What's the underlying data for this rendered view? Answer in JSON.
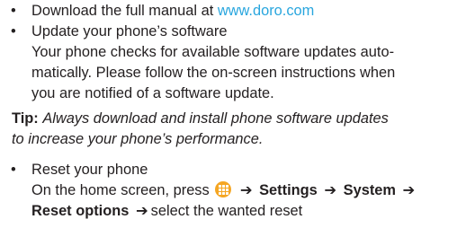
{
  "items": [
    {
      "bullet": "•",
      "prefix": "Download the full manual at ",
      "link": "www.doro.com"
    },
    {
      "bullet": "•",
      "title": "Update your phone’s software",
      "body_lines": [
        "Your phone checks for available software updates auto-",
        "matically. Please follow the on-screen instructions when",
        "you are notified of a software update."
      ]
    },
    {
      "bullet": "•",
      "title": "Reset your phone",
      "line1_prefix": "On the home screen, press",
      "home_icon": "apps-grid-icon",
      "arrow": "➔",
      "settings": "Settings",
      "system": "System",
      "reset_options": "Reset options",
      "line2_suffix": "select the wanted reset"
    }
  ],
  "tip": {
    "label": "Tip:",
    "line1": "Always download and install phone software updates",
    "line2": "to increase your phone’s performance."
  },
  "colors": {
    "link": "#29a6de",
    "home_icon": "#f5a623",
    "text": "#231f20"
  }
}
